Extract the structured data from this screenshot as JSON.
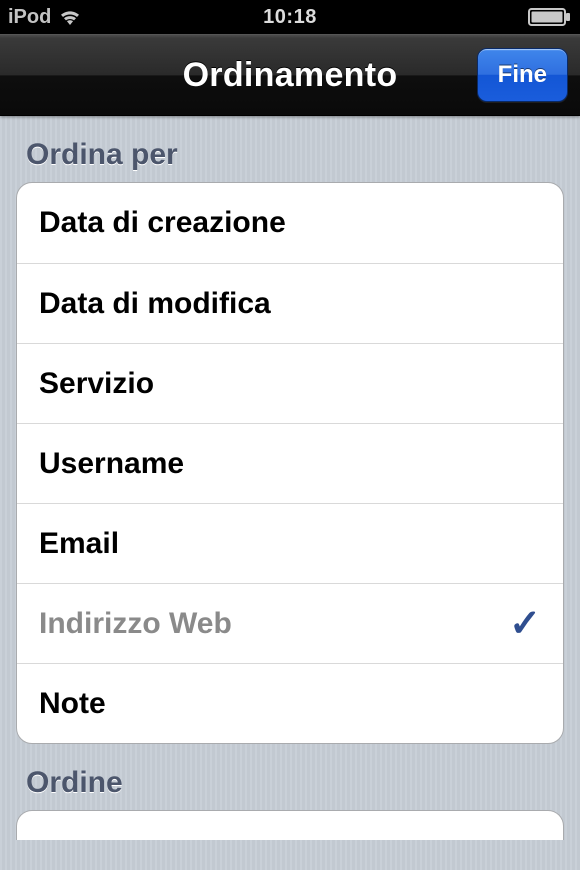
{
  "status": {
    "carrier": "iPod",
    "time": "10:18"
  },
  "nav": {
    "title": "Ordinamento",
    "done_label": "Fine"
  },
  "sections": {
    "sort_by": {
      "header": "Ordina per",
      "options": [
        {
          "label": "Data di creazione",
          "selected": false
        },
        {
          "label": "Data di modifica",
          "selected": false
        },
        {
          "label": "Servizio",
          "selected": false
        },
        {
          "label": "Username",
          "selected": false
        },
        {
          "label": "Email",
          "selected": false
        },
        {
          "label": "Indirizzo Web",
          "selected": true
        },
        {
          "label": "Note",
          "selected": false
        }
      ]
    },
    "order": {
      "header": "Ordine"
    }
  }
}
